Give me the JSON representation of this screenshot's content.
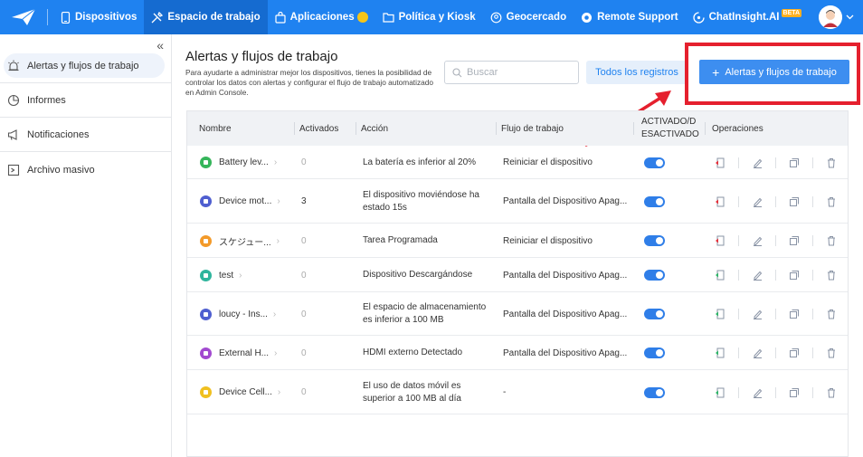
{
  "topnav": {
    "items": [
      {
        "label": "Dispositivos",
        "icon": "device-icon"
      },
      {
        "label": "Espacio de trabajo",
        "icon": "tools-icon",
        "active": true
      },
      {
        "label": "Aplicaciones",
        "icon": "bag-icon"
      },
      {
        "label": "Política y Kiosk",
        "icon": "folder-icon"
      },
      {
        "label": "Geocercado",
        "icon": "geofence-icon"
      },
      {
        "label": "Remote Support",
        "icon": "lifebuoy-icon"
      },
      {
        "label": "ChatInsight.AI",
        "icon": "chat-icon",
        "badge": "BETA"
      }
    ]
  },
  "sidebar": {
    "items": [
      {
        "label": "Alertas y flujos de trabajo",
        "active": true
      },
      {
        "label": "Informes"
      },
      {
        "label": "Notificaciones"
      },
      {
        "label": "Archivo masivo"
      }
    ]
  },
  "main": {
    "title": "Alertas y flujos de trabajo",
    "description": "Para ayudarte a administrar mejor los dispositivos, tienes la posibilidad de controlar los datos con alertas y configurar el flujo de trabajo automatizado en Admin Console.",
    "search_placeholder": "Buscar",
    "logs_button": "Todos los registros",
    "add_button": "Alertas y flujos de trabajo"
  },
  "table": {
    "headers": [
      "Nombre",
      "Activados",
      "Acción",
      "Flujo de trabajo",
      "ACTIVADO/D\nESACTIVADO",
      "Operaciones"
    ],
    "header_status_1": "ACTIVADO/D",
    "header_status_2": "ESACTIVADO",
    "rows": [
      {
        "name": "Battery lev...",
        "count": "0",
        "action": "La batería es inferior al 20%",
        "workflow": "Reiniciar el dispositivo",
        "icon_color": "#35b55a",
        "enabled": true,
        "alert": "red"
      },
      {
        "name": "Device mot...",
        "count": "3",
        "action": "El dispositivo moviéndose ha estado 15s",
        "workflow": "Pantalla del Dispositivo Apag...",
        "icon_color": "#4f5fd0",
        "enabled": true,
        "alert": "red"
      },
      {
        "name": "スケジュー...",
        "count": "0",
        "action": "Tarea Programada",
        "workflow": "Reiniciar el dispositivo",
        "icon_color": "#f39a2a",
        "enabled": true,
        "alert": "red"
      },
      {
        "name": "test",
        "count": "0",
        "action": "Dispositivo Descargándose",
        "workflow": "Pantalla del Dispositivo Apag...",
        "icon_color": "#2fb59d",
        "enabled": true,
        "alert": "green"
      },
      {
        "name": "loucy - Ins...",
        "count": "0",
        "action": "El espacio de almacenamiento es inferior a 100 MB",
        "workflow": "Pantalla del Dispositivo Apag...",
        "icon_color": "#4f5fd0",
        "enabled": true,
        "alert": "green"
      },
      {
        "name": "External H...",
        "count": "0",
        "action": "HDMI externo Detectado",
        "workflow": "Pantalla del Dispositivo Apag...",
        "icon_color": "#a24ad0",
        "enabled": true,
        "alert": "green"
      },
      {
        "name": "Device Cell...",
        "count": "0",
        "action": "El uso de datos móvil es superior a 100 MB al día",
        "workflow": "-",
        "icon_color": "#f0c020",
        "enabled": true,
        "alert": "green"
      }
    ]
  },
  "colors": {
    "primary": "#1f82f0",
    "highlight": "#e5202e"
  }
}
